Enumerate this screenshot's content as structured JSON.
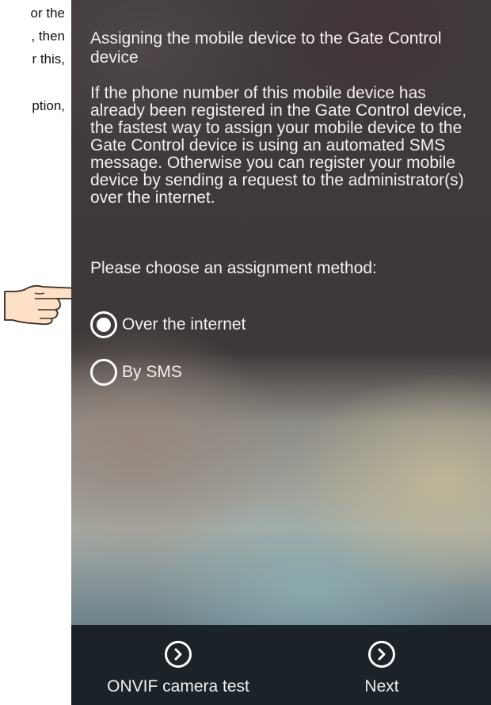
{
  "doc_fragments": [
    "or the",
    ", then",
    "r this,",
    "ption,"
  ],
  "phone": {
    "title": "Assigning the mobile device to the Gate Control device",
    "body": "If the phone number of this mobile device has already been registered in the Gate Control device, the fastest way to assign your mobile device to the Gate Control device is using an automated SMS message. Otherwise you can register your mobile device by sending a request to the administrator(s) over the internet.",
    "prompt": "Please choose an assignment method:",
    "options": [
      {
        "label": "Over the internet",
        "selected": true
      },
      {
        "label": "By SMS",
        "selected": false
      }
    ],
    "bottom_bar": {
      "left_button": {
        "label": "ONVIF camera test",
        "icon": "chevron-right-circle-icon"
      },
      "right_button": {
        "label": "Next",
        "icon": "chevron-right-circle-icon"
      }
    }
  },
  "colors": {
    "bottom_bar": "#1b2329",
    "text": "#f3f0ee",
    "hand_skin": "#fde0c5"
  }
}
